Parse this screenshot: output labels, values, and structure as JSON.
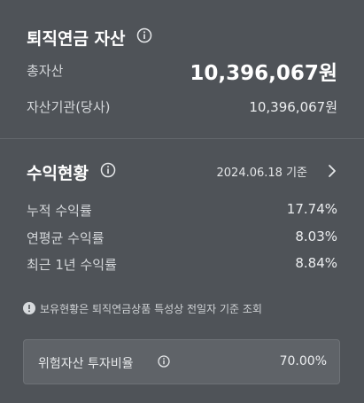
{
  "assets": {
    "title": "퇴직연금 자산",
    "total_label": "총자산",
    "total_value": "10,396,067원",
    "institution_label": "자산기관(당사)",
    "institution_value": "10,396,067원"
  },
  "returns": {
    "title": "수익현황",
    "base_date": "2024.06.18 기준",
    "rows": [
      {
        "label": "누적 수익률",
        "value": "17.74%"
      },
      {
        "label": "연평균 수익률",
        "value": "8.03%"
      },
      {
        "label": "최근 1년 수익률",
        "value": "8.84%"
      }
    ],
    "notice": "보유현황은 퇴직연금상품 특성상 전일자 기준 조회"
  },
  "risk": {
    "label": "위험자산 투자비율",
    "value": "70.00%"
  },
  "colors": {
    "background": "#4f5358",
    "panel": "#5f6368",
    "text": "#eceef0"
  }
}
